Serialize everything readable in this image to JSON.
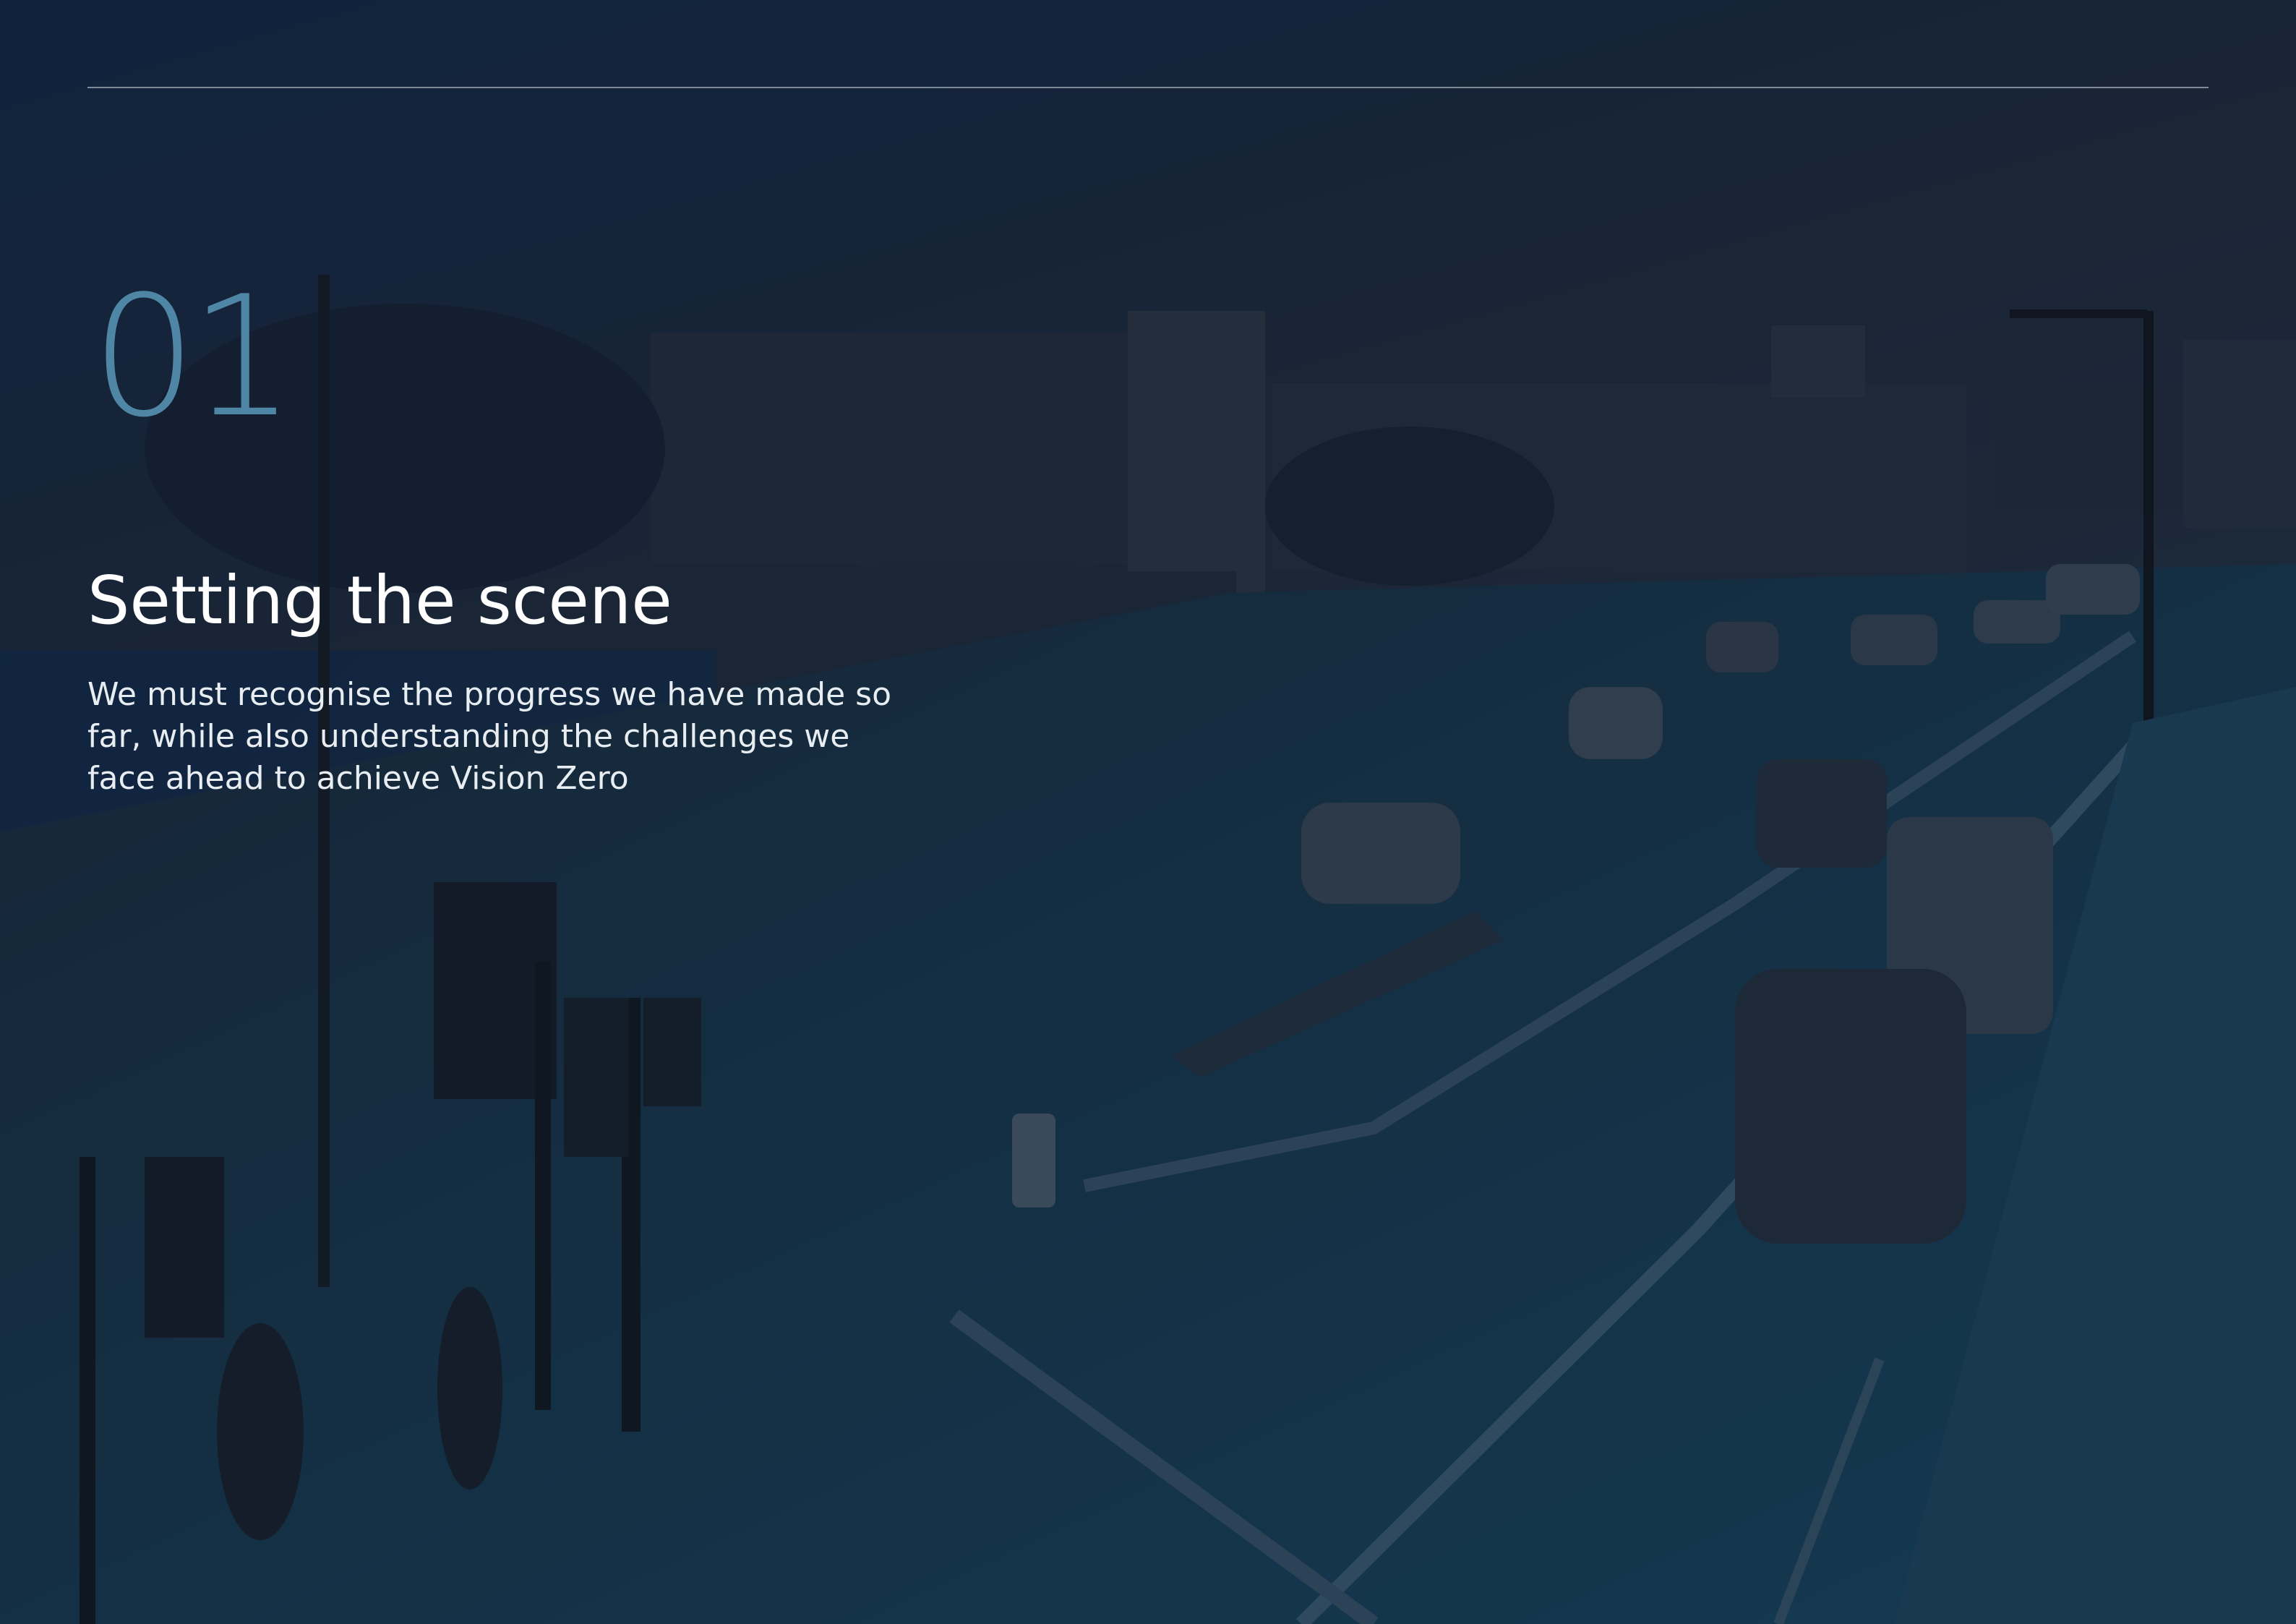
{
  "header": {
    "rule": true
  },
  "section": {
    "number": "01",
    "title": "Setting the scene",
    "intro": "We must recognise the progress we have made so far, while also understanding the challenges we face ahead to achieve Vision Zero"
  },
  "background": {
    "image": "darkened street scene with roundabout, memorial tower, buildings, cars and cyclist",
    "overlay_color": "#0f2440",
    "accent_color": "#4f86a5"
  }
}
